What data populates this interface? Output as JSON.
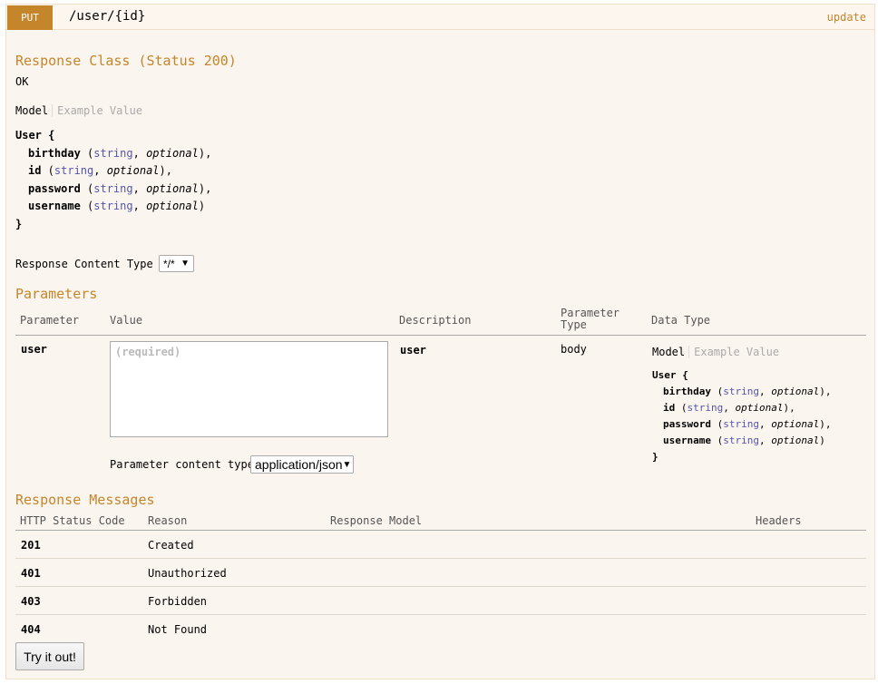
{
  "operation": {
    "method": "PUT",
    "path": "/user/{id}",
    "summary": "update"
  },
  "response_class": {
    "heading": "Response Class (Status 200)",
    "description": "OK",
    "tabs": {
      "model": "Model",
      "example": "Example Value"
    },
    "model": {
      "name": "User",
      "open_brace": "{",
      "close_brace": "}",
      "fields": [
        {
          "name": "birthday",
          "type": "string",
          "opt": "optional",
          "tail": "),"
        },
        {
          "name": "id",
          "type": "string",
          "opt": "optional",
          "tail": "),"
        },
        {
          "name": "password",
          "type": "string",
          "opt": "optional",
          "tail": "),"
        },
        {
          "name": "username",
          "type": "string",
          "opt": "optional",
          "tail": ")"
        }
      ]
    }
  },
  "response_content_type": {
    "label": "Response Content Type",
    "value": "*/*"
  },
  "parameters": {
    "heading": "Parameters",
    "columns": [
      "Parameter",
      "Value",
      "Description",
      "Parameter Type",
      "Data Type"
    ],
    "param_type_line1": "Parameter",
    "param_type_line2": "Type",
    "row": {
      "name": "user",
      "placeholder": "(required)",
      "description": "user",
      "param_type": "body",
      "content_type_label": "Parameter content type:",
      "content_type_value": "application/json",
      "tabs": {
        "model": "Model",
        "example": "Example Value"
      }
    }
  },
  "response_messages": {
    "heading": "Response Messages",
    "columns": [
      "HTTP Status Code",
      "Reason",
      "Response Model",
      "Headers"
    ],
    "rows": [
      {
        "code": "201",
        "reason": "Created"
      },
      {
        "code": "401",
        "reason": "Unauthorized"
      },
      {
        "code": "403",
        "reason": "Forbidden"
      },
      {
        "code": "404",
        "reason": "Not Found"
      }
    ]
  },
  "try_button": "Try it out!",
  "colors": {
    "accent": "#c5862b",
    "panel_bg": "#faf5ee",
    "border": "#f0e0ca",
    "type_blue": "#5555aa"
  },
  "icons": {
    "select_arrow": "dropdown-arrow-icon",
    "resize": "resize-grip-icon"
  }
}
